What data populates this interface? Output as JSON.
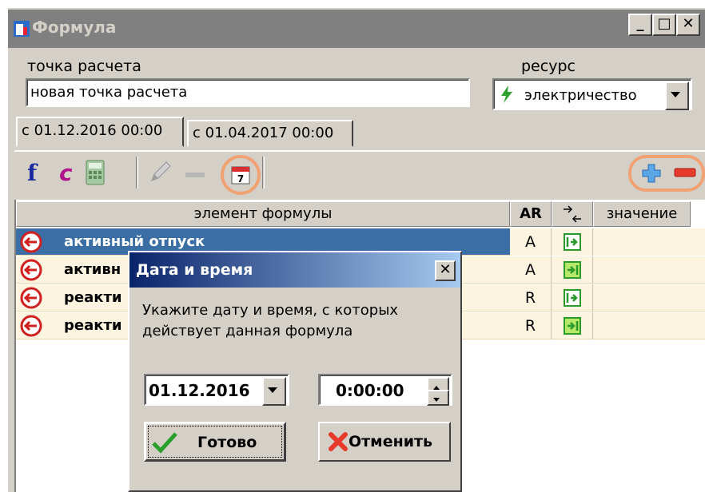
{
  "window": {
    "title": "Формула"
  },
  "form": {
    "point_label": "точка расчета",
    "point_value": "новая точка расчета",
    "resource_label": "ресурс",
    "resource_value": "электричество"
  },
  "tabs": [
    {
      "label": "с 01.12.2016 00:00"
    },
    {
      "label": "с 01.04.2017 00:00"
    }
  ],
  "grid": {
    "headers": {
      "element": "элемент формулы",
      "ar": "AR",
      "dir": "↔",
      "value": "значение"
    },
    "rows": [
      {
        "name": "активный отпуск",
        "ar": "A",
        "selected": true
      },
      {
        "name": "активн",
        "ar": "A",
        "selected": false
      },
      {
        "name": "реакти",
        "ar": "R",
        "selected": false
      },
      {
        "name": "реакти",
        "ar": "R",
        "selected": false
      }
    ]
  },
  "dialog": {
    "title": "Дата и время",
    "message_line1": "Укажите дату и время, с которых",
    "message_line2": "действует данная формула",
    "date_value": "01.12.2016",
    "time_value": "0:00:00",
    "ok_label": "Готово",
    "cancel_label": "Отменить"
  },
  "colors": {
    "selection": "#3a6ea5",
    "highlight": "#f0a272",
    "row_bg": "#fdf4e0"
  }
}
